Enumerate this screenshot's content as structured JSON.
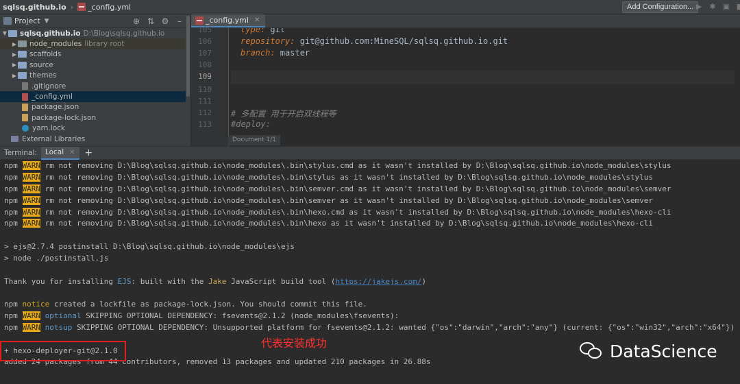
{
  "navbar": {
    "project": "sqlsq.github.io",
    "file": "_config.yml",
    "add_configuration": "Add Configuration..."
  },
  "project_panel": {
    "title": "Project",
    "tree": [
      {
        "label": "sqlsq.github.io",
        "note": "D:\\Blog\\sqlsq.github.io",
        "kind": "folder",
        "expanded": true
      },
      {
        "label": "node_modules",
        "note": "library root",
        "kind": "folder-dark"
      },
      {
        "label": "scaffolds",
        "note": "",
        "kind": "folder"
      },
      {
        "label": "source",
        "note": "",
        "kind": "folder"
      },
      {
        "label": "themes",
        "note": "",
        "kind": "folder"
      },
      {
        "label": ".gitignore",
        "note": "",
        "kind": "git"
      },
      {
        "label": "_config.yml",
        "note": "",
        "kind": "yml",
        "selected": true
      },
      {
        "label": "package.json",
        "note": "",
        "kind": "json"
      },
      {
        "label": "package-lock.json",
        "note": "",
        "kind": "json"
      },
      {
        "label": "yarn.lock",
        "note": "",
        "kind": "yarn"
      },
      {
        "label": "External Libraries",
        "note": "",
        "kind": "lib"
      }
    ]
  },
  "editor": {
    "tab": "_config.yml",
    "status": "Document 1/1",
    "lines": [
      {
        "num": "105",
        "key": "type:",
        "value": " git",
        "comment": ""
      },
      {
        "num": "106",
        "key": "repository:",
        "value": " git@github.com:MineSQL/sqlsq.github.io.git",
        "comment": ""
      },
      {
        "num": "107",
        "key": "branch:",
        "value": " master",
        "comment": ""
      },
      {
        "num": "108",
        "key": "",
        "value": "",
        "comment": ""
      },
      {
        "num": "109",
        "key": "",
        "value": "",
        "comment": ""
      },
      {
        "num": "110",
        "key": "",
        "value": "",
        "comment": ""
      },
      {
        "num": "111",
        "key": "",
        "value": "",
        "comment": ""
      },
      {
        "num": "112",
        "key": "",
        "value": "",
        "comment": "# 多配置 用于开启双线程等"
      },
      {
        "num": "113",
        "key": "",
        "value": "",
        "comment": "#deploy:"
      }
    ]
  },
  "terminal": {
    "title": "Terminal:",
    "tab": "Local",
    "warn_lines": [
      "rm not removing D:\\Blog\\sqlsq.github.io\\node_modules\\.bin\\stylus.cmd as it wasn't installed by D:\\Blog\\sqlsq.github.io\\node_modules\\stylus",
      "rm not removing D:\\Blog\\sqlsq.github.io\\node_modules\\.bin\\stylus as it wasn't installed by D:\\Blog\\sqlsq.github.io\\node_modules\\stylus",
      "rm not removing D:\\Blog\\sqlsq.github.io\\node_modules\\.bin\\semver.cmd as it wasn't installed by D:\\Blog\\sqlsq.github.io\\node_modules\\semver",
      "rm not removing D:\\Blog\\sqlsq.github.io\\node_modules\\.bin\\semver as it wasn't installed by D:\\Blog\\sqlsq.github.io\\node_modules\\semver",
      "rm not removing D:\\Blog\\sqlsq.github.io\\node_modules\\.bin\\hexo.cmd as it wasn't installed by D:\\Blog\\sqlsq.github.io\\node_modules\\hexo-cli",
      "rm not removing D:\\Blog\\sqlsq.github.io\\node_modules\\.bin\\hexo as it wasn't installed by D:\\Blog\\sqlsq.github.io\\node_modules\\hexo-cli"
    ],
    "npm": "npm",
    "warn": "WARN",
    "postinstall_1": "> ejs@2.7.4 postinstall D:\\Blog\\sqlsq.github.io\\node_modules\\ejs",
    "postinstall_2": "> node ./postinstall.js",
    "thanks_pre": "Thank you for installing ",
    "thanks_ejs": "EJS",
    "thanks_mid": ": built with the ",
    "thanks_jake": "Jake",
    "thanks_post": " JavaScript build tool (",
    "thanks_link": "https://jakejs.com/",
    "thanks_end": ")",
    "notice_word": "notice",
    "notice_text": " created a lockfile as package-lock.json. You should commit this file.",
    "optional_word": "optional",
    "optional_text": " SKIPPING OPTIONAL DEPENDENCY: fsevents@2.1.2 (node_modules\\fsevents):",
    "notsup_word": "notsup",
    "notsup_text": " SKIPPING OPTIONAL DEPENDENCY: Unsupported platform for fsevents@2.1.2: wanted {\"os\":\"darwin\",\"arch\":\"any\"} (current: {\"os\":\"win32\",\"arch\":\"x64\"})",
    "installed": "+ hexo-deployer-git@2.1.0",
    "summary": "added 24 packages from 44 contributors, removed 13 packages and updated 210 packages in 26.88s"
  },
  "annotation": "代表安装成功",
  "watermark": "DataScience"
}
